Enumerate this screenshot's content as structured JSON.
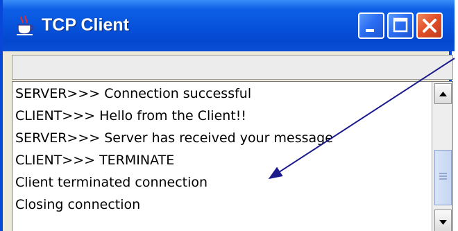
{
  "window": {
    "title": "TCP Client",
    "colors": {
      "titlebar": "#0753dc",
      "close_button": "#e2502a",
      "annotation_arrow": "#1a1a8c"
    }
  },
  "input": {
    "value": ""
  },
  "output": {
    "lines": [
      "SERVER>>> Connection successful",
      "CLIENT>>> Hello from the Client!!",
      "SERVER>>> Server has received your message",
      "CLIENT>>> TERMINATE",
      "Client terminated connection",
      "Closing connection"
    ]
  },
  "icons": {
    "app": "java-coffee-cup-icon",
    "minimize": "minimize-icon",
    "maximize": "maximize-icon",
    "close": "close-icon",
    "scroll_up": "scroll-up-arrow-icon",
    "scroll_down": "scroll-down-arrow-icon"
  }
}
